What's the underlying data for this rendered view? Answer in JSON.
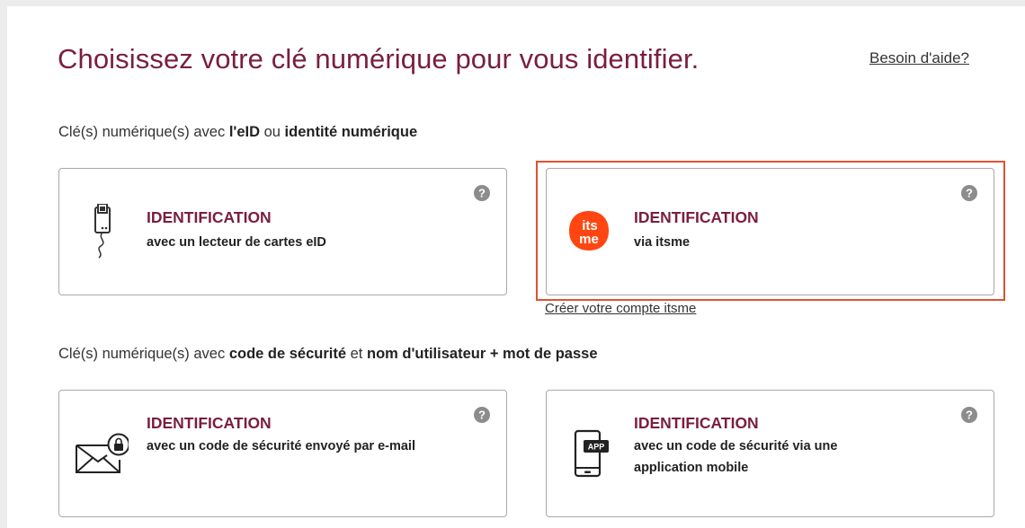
{
  "header": {
    "title": "Choisissez votre clé numérique pour vous identifier.",
    "help_link": "Besoin d'aide?"
  },
  "section_eid": {
    "prefix": "Clé(s) numérique(s) avec ",
    "bold1": "l'eID",
    "mid": " ou ",
    "bold2": "identité numérique"
  },
  "section_code": {
    "prefix": "Clé(s) numérique(s) avec ",
    "bold1": "code de sécurité",
    "mid": " et ",
    "bold2": "nom d'utilisateur + mot de passe"
  },
  "cards": {
    "eid_reader": {
      "title": "IDENTIFICATION",
      "subtitle": "avec un lecteur de cartes eID",
      "icon": "card-reader-icon"
    },
    "itsme": {
      "title": "IDENTIFICATION",
      "subtitle": "via itsme",
      "icon": "itsme-logo",
      "logo_text_top": "its",
      "logo_text_bottom": "me"
    },
    "email_code": {
      "title": "IDENTIFICATION",
      "subtitle": "avec un code de sécurité envoyé par e-mail",
      "icon": "email-lock-icon"
    },
    "app_code": {
      "title": "IDENTIFICATION",
      "subtitle": "avec un code de sécurité via une application mobile",
      "icon": "mobile-app-icon",
      "app_badge": "APP"
    }
  },
  "itsme_create_link": "Créer votre compte itsme",
  "colors": {
    "title": "#7a1e3d",
    "highlight": "#e05233",
    "itsme_orange": "#ff4612"
  }
}
